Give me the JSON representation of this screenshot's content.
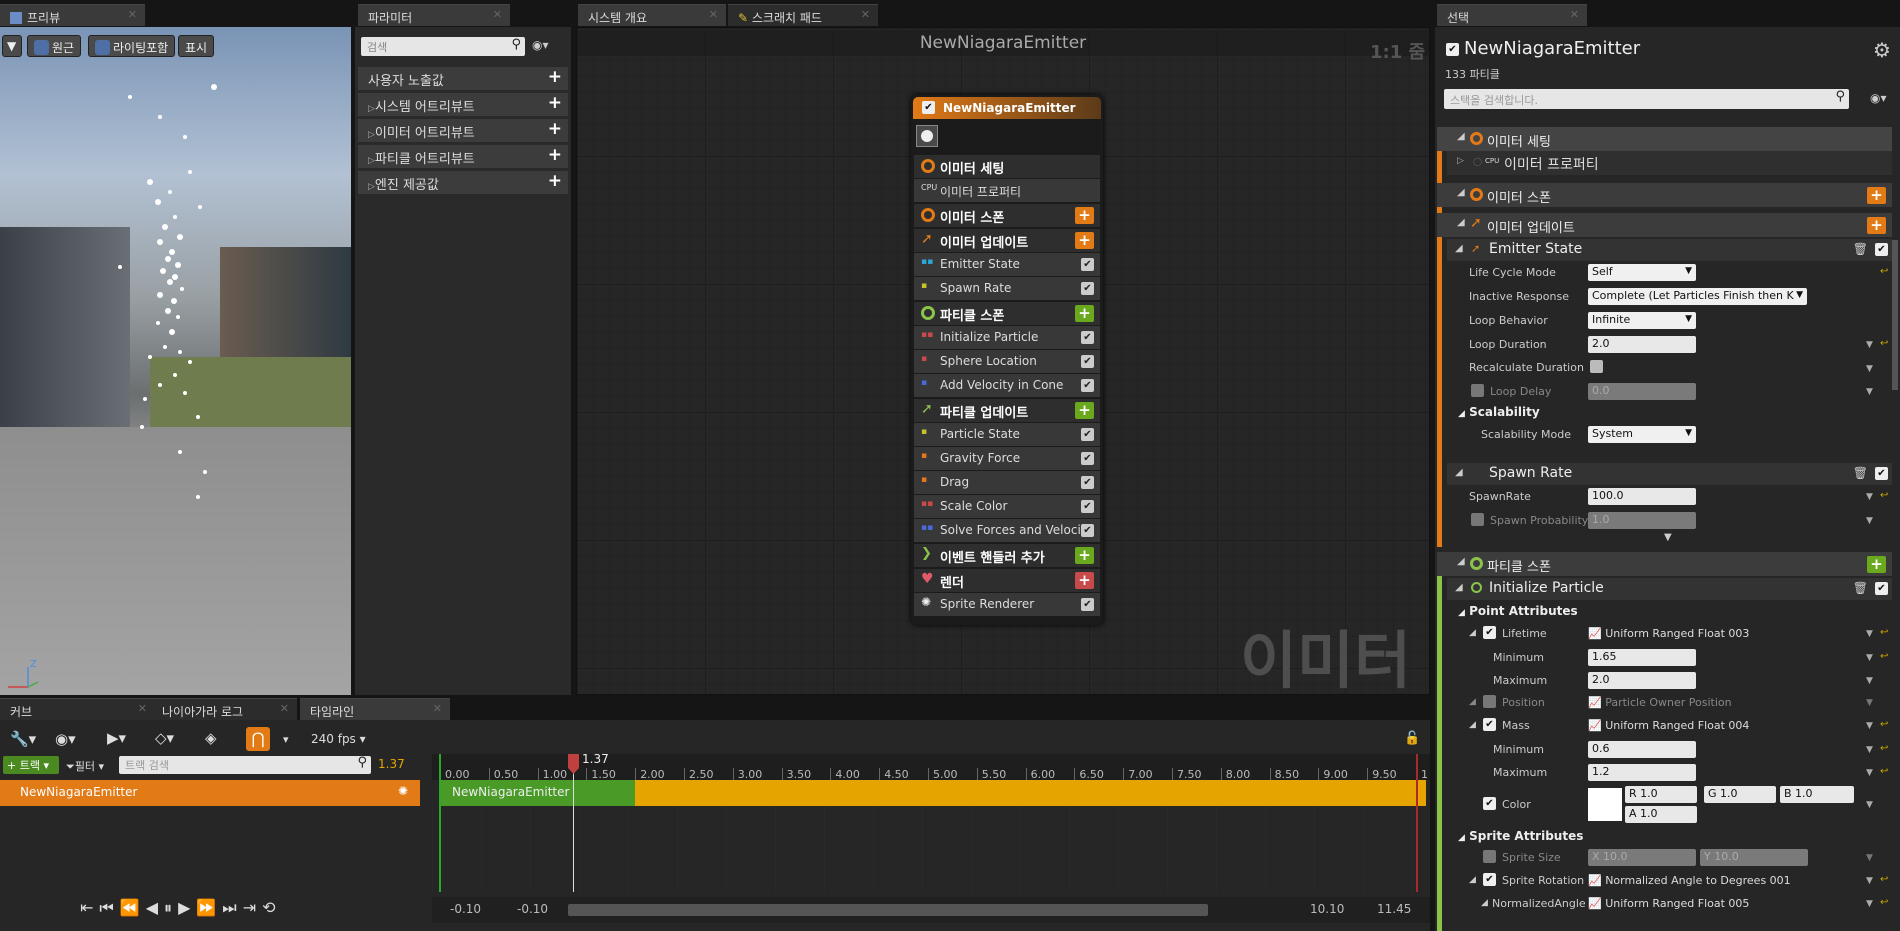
{
  "tabs": {
    "preview": "프리뷰",
    "parameters": "파라미터",
    "system_overview": "시스템 개요",
    "scratch_pad": "스크래치 패드",
    "selection": "선택",
    "curve": "커브",
    "niagara_log": "나이아가라 로그",
    "timeline": "타임라인"
  },
  "preview_toolbar": {
    "perspective": "원근",
    "lighting": "라이팅포함",
    "show": "표시"
  },
  "params": {
    "search_placeholder": "검색",
    "items": [
      "사용자 노출값",
      "시스템 어트리뷰트",
      "이미터 어트리뷰트",
      "파티클 어트리뷰트",
      "엔진 제공값"
    ]
  },
  "graph": {
    "title": "NewNiagaraEmitter",
    "zoom": "1:1 줌",
    "watermark": "이미터",
    "node_title": "NewNiagaraEmitter",
    "rows": {
      "emitter_settings": "이미터 세팅",
      "emitter_props": "이미터 프로퍼티",
      "emitter_spawn": "이미터 스폰",
      "emitter_update": "이미터 업데이트",
      "emitter_state": "Emitter State",
      "spawn_rate": "Spawn Rate",
      "particle_spawn": "파티클 스폰",
      "init_particle": "Initialize Particle",
      "sphere_loc": "Sphere Location",
      "add_velocity": "Add Velocity in Cone",
      "particle_update": "파티클 업데이트",
      "particle_state": "Particle State",
      "gravity": "Gravity Force",
      "drag": "Drag",
      "scale_color": "Scale Color",
      "solve_forces": "Solve Forces and Velocity",
      "event_handler": "이벤트 핸들러 추가",
      "render": "렌더",
      "sprite_renderer": "Sprite Renderer"
    }
  },
  "selection": {
    "title": "NewNiagaraEmitter",
    "particle_count": "133 파티클",
    "search_placeholder": "스택을 검색합니다.",
    "emitter_settings": "이미터 세팅",
    "emitter_props": "이미터 프로퍼티",
    "emitter_spawn": "이미터 스폰",
    "emitter_update": "이미터 업데이트",
    "emitter_state": "Emitter State",
    "life_cycle_mode_label": "Life Cycle Mode",
    "life_cycle_mode": "Self",
    "inactive_response_label": "Inactive Response",
    "inactive_response": "Complete (Let Particles Finish then K",
    "loop_behavior_label": "Loop Behavior",
    "loop_behavior": "Infinite",
    "loop_duration_label": "Loop Duration",
    "loop_duration": "2.0",
    "recalc_label": "Recalculate Duration",
    "loop_delay_label": "Loop Delay",
    "loop_delay": "0.0",
    "scalability": "Scalability",
    "scalability_mode_label": "Scalability Mode",
    "scalability_mode": "System",
    "spawn_rate": "Spawn Rate",
    "spawnrate_label": "SpawnRate",
    "spawnrate": "100.0",
    "spawn_prob_label": "Spawn Probability",
    "spawn_prob": "1.0",
    "particle_spawn": "파티클 스폰",
    "init_particle": "Initialize Particle",
    "point_attrs": "Point Attributes",
    "lifetime_label": "Lifetime",
    "lifetime_val": "Uniform Ranged Float 003",
    "minimum_label": "Minimum",
    "maximum_label": "Maximum",
    "lt_min": "1.65",
    "lt_max": "2.0",
    "position_label": "Position",
    "position_val": "Particle Owner Position",
    "mass_label": "Mass",
    "mass_val": "Uniform Ranged Float 004",
    "mass_min": "0.6",
    "mass_max": "1.2",
    "color_label": "Color",
    "r": "R 1.0",
    "g": "G 1.0",
    "b": "B 1.0",
    "a": "A 1.0",
    "sprite_attrs": "Sprite Attributes",
    "sprite_size_label": "Sprite Size",
    "sx": "X 10.0",
    "sy": "Y 10.0",
    "sprite_rot_label": "Sprite Rotation",
    "sprite_rot_val": "Normalized Angle to Degrees 001",
    "norm_angle_label": "NormalizedAngle",
    "norm_angle_val": "Uniform Ranged Float 005"
  },
  "timeline": {
    "fps": "240 fps",
    "track_btn": "트랙",
    "filter": "필터",
    "track_search": "트랙 검색",
    "current_time": "1.37",
    "scrub_time": "1.37",
    "track_name": "NewNiagaraEmitter",
    "segment_label": "NewNiagaraEmitter",
    "ticks": [
      "0.00",
      "0.50",
      "1.00",
      "1.50",
      "2.00",
      "2.50",
      "3.00",
      "3.50",
      "4.00",
      "4.50",
      "5.00",
      "5.50",
      "6.00",
      "6.50",
      "7.00",
      "7.50",
      "8.00",
      "8.50",
      "9.00",
      "9.50",
      "1"
    ],
    "range_start1": "-0.10",
    "range_start2": "-0.10",
    "range_end1": "10.10",
    "range_end2": "11.45"
  },
  "colors": {
    "orange": "#e27a16",
    "green": "#6aa81e",
    "red": "#c94a4a",
    "track_orange": "#e6a400"
  }
}
